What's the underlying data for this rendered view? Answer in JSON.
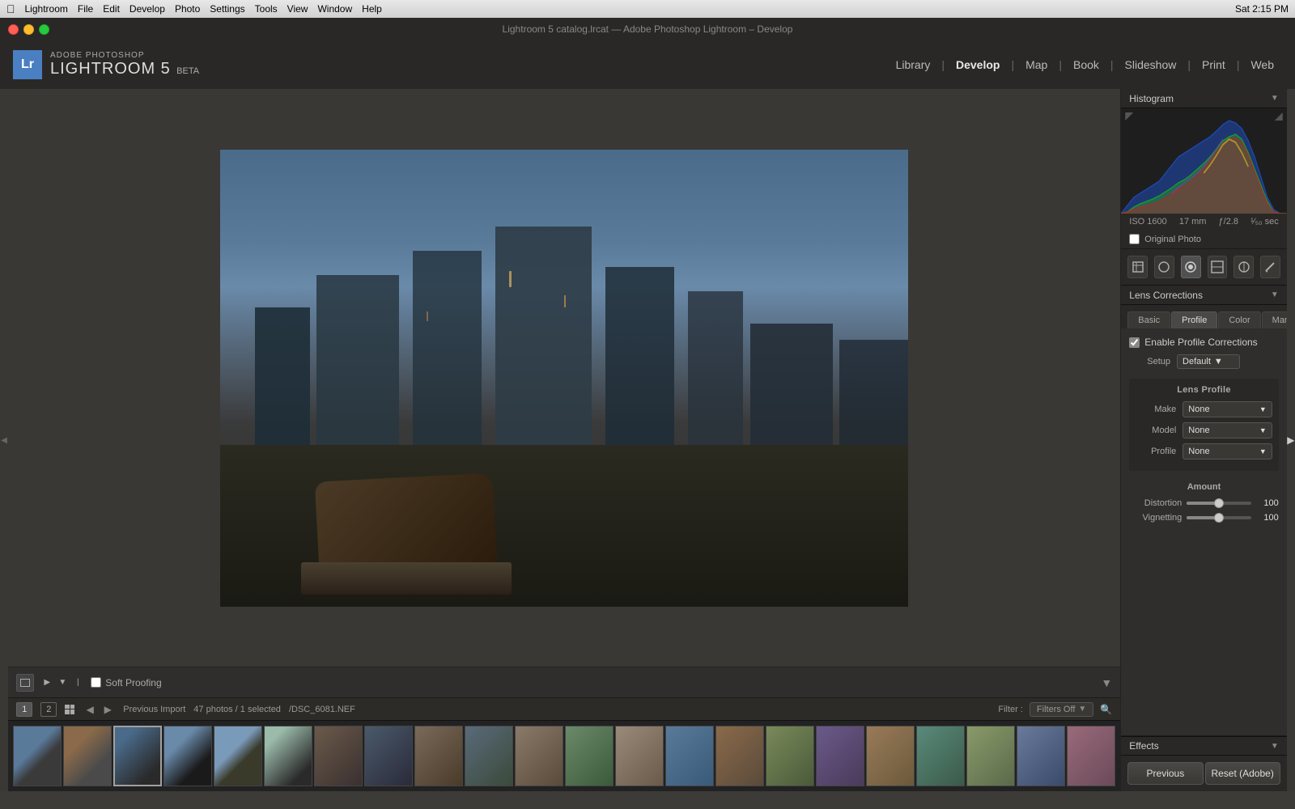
{
  "macbar": {
    "apple": "&#63743;",
    "menus": [
      "Lightroom",
      "File",
      "Edit",
      "Develop",
      "Photo",
      "Settings",
      "Tools",
      "View",
      "Window",
      "Help"
    ],
    "time": "Sat 2:15 PM"
  },
  "titlebar": {
    "text": "Lightroom 5 catalog.lrcat — Adobe Photoshop Lightroom – Develop"
  },
  "appheader": {
    "badge": "Lr",
    "adobe_label": "ADOBE PHOTOSHOP",
    "lr5_label": "LIGHTROOM 5",
    "beta_label": "BETA"
  },
  "nav": {
    "items": [
      {
        "label": "Library",
        "active": false
      },
      {
        "label": "Develop",
        "active": true
      },
      {
        "label": "Map",
        "active": false
      },
      {
        "label": "Book",
        "active": false
      },
      {
        "label": "Slideshow",
        "active": false
      },
      {
        "label": "Print",
        "active": false
      },
      {
        "label": "Web",
        "active": false
      }
    ]
  },
  "histogram": {
    "title": "Histogram",
    "iso": "ISO 1600",
    "mm": "17 mm",
    "fstop": "ƒ/2.8",
    "shutter": "¹⁄₅₀ sec",
    "original_photo_label": "Original Photo"
  },
  "tools": {
    "icons": [
      "⊞",
      "○",
      "◎",
      "⊠",
      "◎",
      "—"
    ]
  },
  "lens_corrections": {
    "title": "Lens Corrections",
    "tabs": [
      "Basic",
      "Profile",
      "Color",
      "Manual"
    ],
    "active_tab": "Profile",
    "enable_profile_label": "Enable Profile Corrections",
    "setup_label": "Setup",
    "setup_value": "Default",
    "lens_profile_title": "Lens Profile",
    "make_label": "Make",
    "make_value": "None",
    "model_label": "Model",
    "model_value": "None",
    "profile_label": "Profile",
    "profile_value": "None",
    "amount_title": "Amount",
    "distortion_label": "Distortion",
    "distortion_value": "100",
    "distortion_pct": 50,
    "vignetting_label": "Vignetting",
    "vignetting_value": "100",
    "vignetting_pct": 50
  },
  "effects": {
    "title": "Effects"
  },
  "actions": {
    "previous_label": "Previous",
    "reset_label": "Reset (Adobe)"
  },
  "toolbar": {
    "soft_proofing_label": "Soft Proofing"
  },
  "statusbar": {
    "tab1": "1",
    "tab2": "2",
    "import_label": "Previous Import",
    "count_label": "47 photos / 1 selected",
    "filename": "/DSC_6081.NEF",
    "filter_label": "Filter :",
    "filter_value": "Filters Off"
  }
}
